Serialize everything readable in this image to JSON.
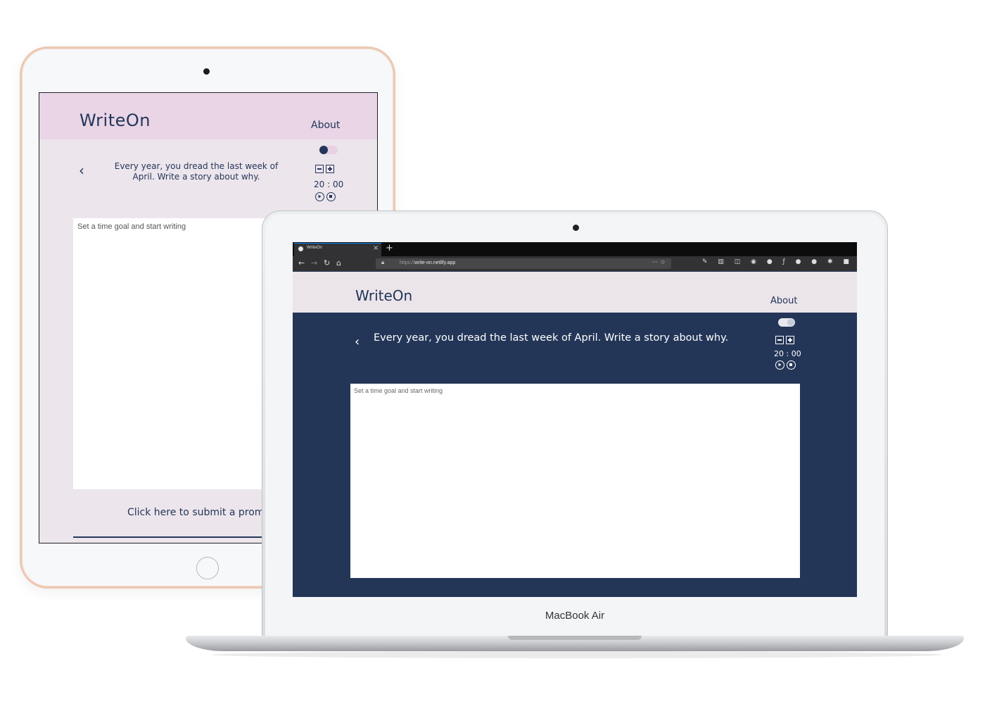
{
  "ipad_app": {
    "logo": "WriteOn",
    "nav_about": "About",
    "prompt": "Every year, you dread the last week of April. Write a story about why.",
    "timer": "20 : 00",
    "editor_placeholder": "Set a time goal and start writing",
    "submit_link": "Click here to submit a promp"
  },
  "macbook": {
    "model_label": "MacBook Air"
  },
  "browser": {
    "tab_title": "WriteOn",
    "url_scheme": "https://",
    "url_host": "write-on.netlify.app"
  },
  "desktop_app": {
    "logo": "WriteOn",
    "nav_about": "About",
    "prompt": "Every year, you dread the last week of April. Write a story about why.",
    "timer": "20 : 00",
    "editor_placeholder": "Set a time goal and start writing"
  },
  "colors": {
    "navy": "#24365a",
    "ipad_header": "#e9d5e6",
    "ipad_bg": "#ece5ec",
    "desktop_header": "#ebe5ea",
    "desktop_bg": "#243658"
  },
  "icons": {
    "back": "chevron-left-icon",
    "decrease": "minus-square-icon",
    "increase": "plus-square-icon",
    "play": "play-circle-icon",
    "stop": "stop-circle-icon",
    "theme": "toggle-switch"
  }
}
